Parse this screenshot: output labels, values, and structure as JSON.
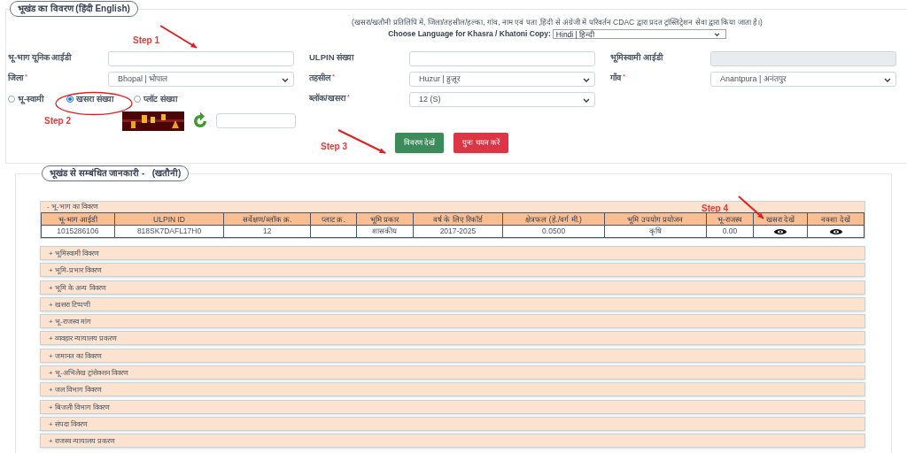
{
  "section1": {
    "legend": "भूखंड का विवरण  (हिंदी  English)",
    "note": "(खसरा/खतौनी प्रतिलिपि में, जिला/तहसील/हल्का, गांव, नाम एवं पता ,हिंदी से अंग्रेजी में परिवर्तन CDAC द्वारा प्रदत ट्रांस्लिट्रेशन सेवा द्वारा किया जाता है।)",
    "language_label": "Choose Language for Khasra / Khatoni Copy:",
    "language_value": "Hindi | हिन्दी",
    "field_rows": [
      [
        {
          "label": "भू-भाग यूनिक आईडी",
          "kind": "text"
        },
        {
          "label": "ULPIN संख्या",
          "kind": "text"
        },
        {
          "label": "भूमिस्वामी आईडी",
          "kind": "readonly"
        }
      ],
      [
        {
          "label": "जिला",
          "required_mark": "*",
          "kind": "select",
          "value": "Bhopal | भोपाल"
        },
        {
          "label": "तहसील",
          "required_mark": "*",
          "kind": "select",
          "value": "Huzur | हुज़ूर"
        },
        {
          "label": "गाँव",
          "required_mark": "*",
          "kind": "select",
          "value": "Anantpura | अनंतपुर"
        }
      ]
    ],
    "search_by": [
      {
        "label": "भू-स्वामी",
        "selected": false
      },
      {
        "label": "खसरा संख्या",
        "selected": true
      },
      {
        "label": "प्लॉट संख्या",
        "selected": false
      }
    ],
    "block_field": {
      "label": "ब्लॉक/खसरा",
      "required_mark": "*",
      "value": "12 (S)"
    },
    "buttons": [
      {
        "label": "विवरण देखें",
        "kind": "primary"
      },
      {
        "label": "पुनः चयन करें",
        "kind": "danger"
      }
    ]
  },
  "annotations": [
    "Step 1",
    "Step 2",
    "Step 3",
    "Step 4"
  ],
  "section2": {
    "legend": "भूखंड से सम्बंधित जानकारी -   (खतौनी)",
    "table_panel": "- भू-भाग का विवरण",
    "columns": [
      "भू-भाग आईडी",
      "ULPIN ID",
      "सर्वेक्षण/ब्लॉक क्र.",
      "प्लाट क्र.",
      "भूमि प्रकार",
      "वर्ष के लिए रिकॉर्ड",
      "क्षेत्रफल (हे./वर्ग मी.)",
      "भूमि उपयोग प्रयोजन",
      "भू-राजस्व",
      "खसरा देखें",
      "नक्शा देखें"
    ],
    "row": [
      {
        "kind": "text",
        "text": "1015286106"
      },
      {
        "kind": "text",
        "text": "818SK7DAFL17H0"
      },
      {
        "kind": "text",
        "text": "12"
      },
      {
        "kind": "empty"
      },
      {
        "kind": "text",
        "text": "शासकीय"
      },
      {
        "kind": "text",
        "text": "2017-2025"
      },
      {
        "kind": "text",
        "text": "0.0500"
      },
      {
        "kind": "text",
        "text": "कृषि"
      },
      {
        "kind": "text",
        "text": "0.00"
      },
      {
        "kind": "view"
      },
      {
        "kind": "view"
      }
    ],
    "panels": [
      "+ भूमिस्वामी विवरण",
      "+ भूमि-प्रभार विवरण",
      "+ भूमि के अन्य विवरण",
      "+ खसरा टिप्पणी",
      "+ भू-राजस्व मांग",
      "+ व्यवहार न्यायालय प्रकरण",
      "+ जमानत का विवरण",
      "+ भू-अभिलेख ट्रांसेक्शन विवरण",
      "+ जल विभाग विवरण",
      "+ बिजली विभाग विवरण",
      "+ संपदा विवरण",
      "+ राजस्व न्यायालय प्रकरण"
    ]
  }
}
